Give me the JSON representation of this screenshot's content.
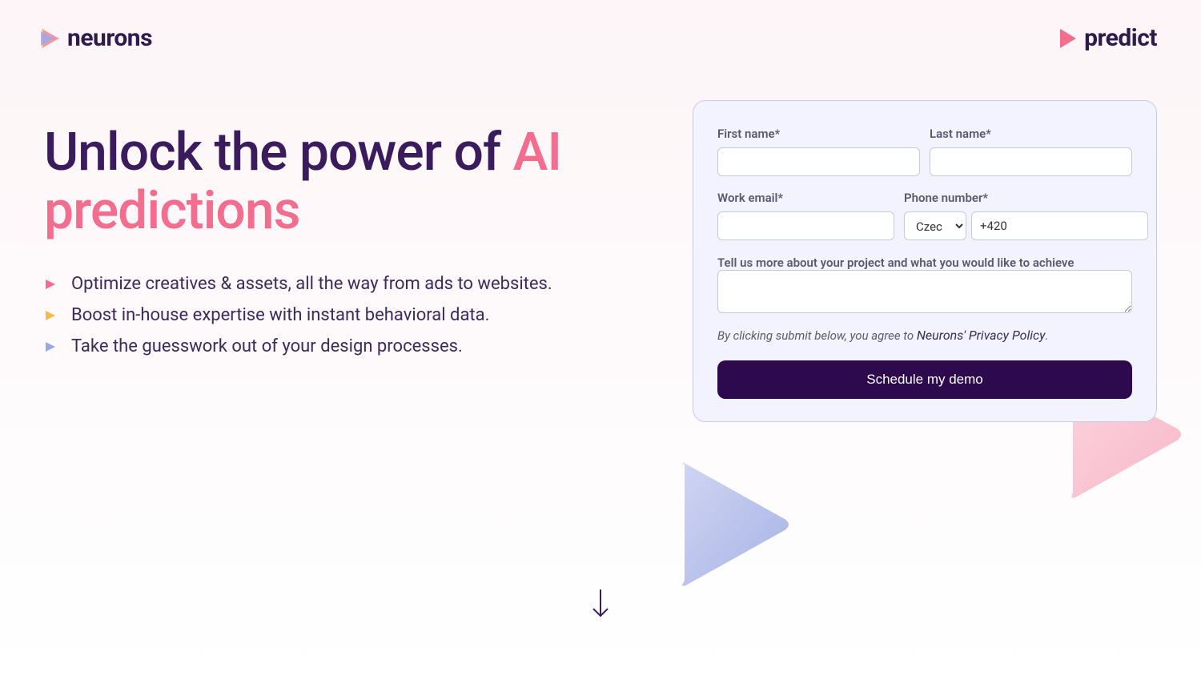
{
  "header": {
    "logo_left": "neurons",
    "logo_right": "predict"
  },
  "hero": {
    "headline_part1": "Unlock the power of ",
    "headline_accent": "AI predictions",
    "bullets": [
      "Optimize creatives & assets, all the way from ads to websites.",
      "Boost in-house expertise with instant behavioral data.",
      "Take the guesswork out of your design processes."
    ]
  },
  "form": {
    "first_name_label": "First name*",
    "last_name_label": "Last name*",
    "work_email_label": "Work email*",
    "phone_label": "Phone number*",
    "country_code_selected": "Czec",
    "phone_prefix": "+420",
    "project_label": "Tell us more about your project and what you would like to achieve",
    "consent_prefix": "By clicking submit below, you agree to ",
    "consent_link": "Neurons' Privacy Policy",
    "consent_suffix": ".",
    "submit_label": "Schedule my demo"
  }
}
